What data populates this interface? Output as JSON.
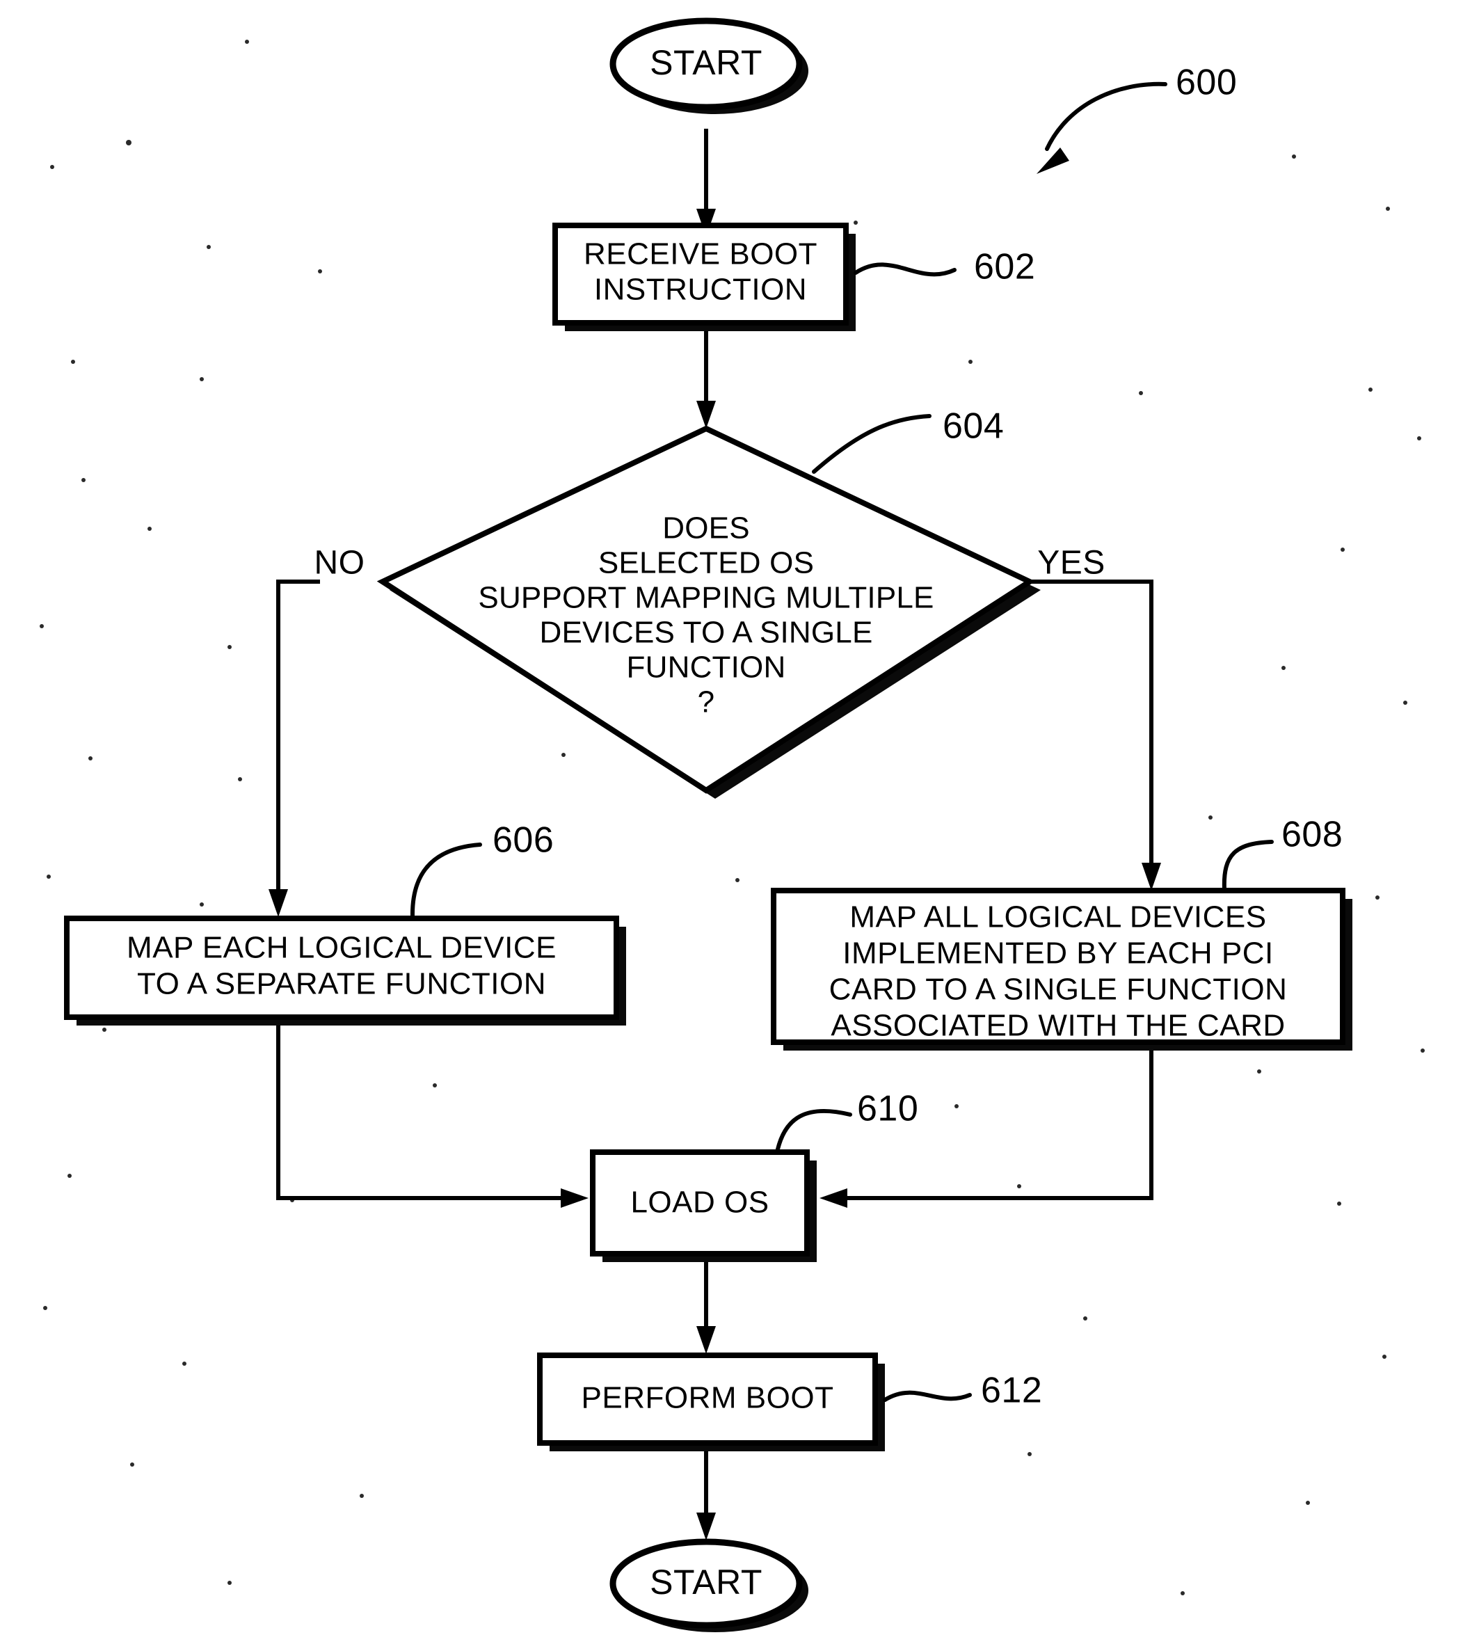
{
  "figure": {
    "reference_number": "600",
    "type": "flowchart"
  },
  "nodes": {
    "start": {
      "label": "START",
      "shape": "oval"
    },
    "receive_boot": {
      "label_line1": "RECEIVE BOOT",
      "label_line2": "INSTRUCTION",
      "ref": "602",
      "shape": "process"
    },
    "decision": {
      "label_line1": "DOES",
      "label_line2": "SELECTED OS",
      "label_line3": "SUPPORT MAPPING MULTIPLE",
      "label_line4": "DEVICES TO A SINGLE",
      "label_line5": "FUNCTION",
      "label_line6": "?",
      "ref": "604",
      "shape": "decision",
      "branch_no": "NO",
      "branch_yes": "YES"
    },
    "map_each": {
      "label_line1": "MAP EACH LOGICAL DEVICE",
      "label_line2": "TO A SEPARATE FUNCTION",
      "ref": "606",
      "shape": "process"
    },
    "map_all": {
      "label_line1": "MAP ALL LOGICAL DEVICES",
      "label_line2": "IMPLEMENTED BY EACH PCI",
      "label_line3": "CARD TO A SINGLE FUNCTION",
      "label_line4": "ASSOCIATED WITH THE CARD",
      "ref": "608",
      "shape": "process"
    },
    "load_os": {
      "label": "LOAD OS",
      "ref": "610",
      "shape": "process"
    },
    "perform_boot": {
      "label": "PERFORM BOOT",
      "ref": "612",
      "shape": "process"
    },
    "end": {
      "label": "START",
      "shape": "oval"
    }
  },
  "colors": {
    "ink": "#000000",
    "paper": "#ffffff"
  }
}
